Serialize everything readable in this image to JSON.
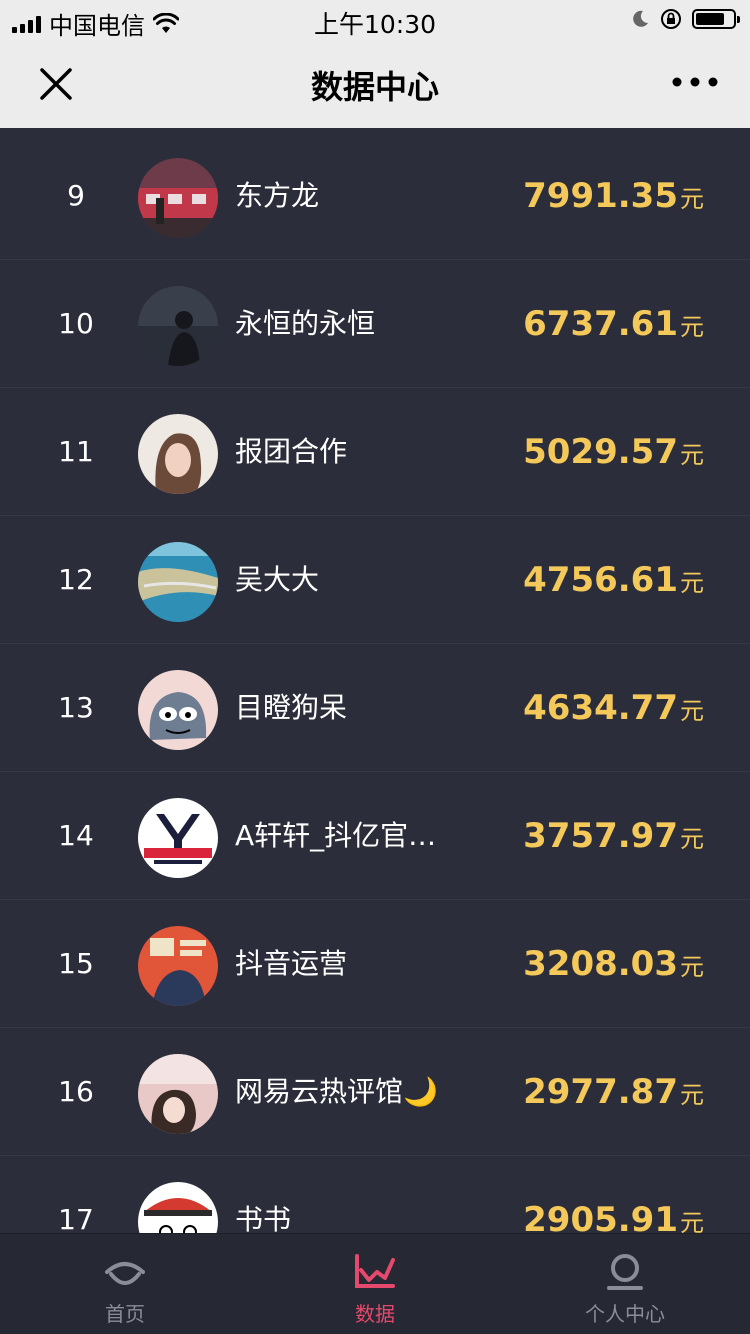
{
  "status_bar": {
    "carrier": "中国电信",
    "time": "上午10:30"
  },
  "nav": {
    "title": "数据中心"
  },
  "ranking": [
    {
      "rank": "9",
      "name": "东方龙",
      "amount": "7991.35",
      "unit": "元",
      "avatar": "red-train-photo"
    },
    {
      "rank": "10",
      "name": "永恒的永恒",
      "amount": "6737.61",
      "unit": "元",
      "avatar": "dark-silhouette-photo"
    },
    {
      "rank": "11",
      "name": "报团合作",
      "amount": "5029.57",
      "unit": "元",
      "avatar": "girl-portrait-photo"
    },
    {
      "rank": "12",
      "name": "吴大大",
      "amount": "4756.61",
      "unit": "元",
      "avatar": "coast-aerial-photo"
    },
    {
      "rank": "13",
      "name": "目瞪狗呆",
      "amount": "4634.77",
      "unit": "元",
      "avatar": "cartoon-cat-image"
    },
    {
      "rank": "14",
      "name": "A轩轩_抖亿官…",
      "amount": "3757.97",
      "unit": "元",
      "avatar": "y-logo-image"
    },
    {
      "rank": "15",
      "name": "抖音运营",
      "amount": "3208.03",
      "unit": "元",
      "avatar": "poster-image"
    },
    {
      "rank": "16",
      "name": "网易云热评馆🌙",
      "amount": "2977.87",
      "unit": "元",
      "avatar": "girl-pink-photo"
    },
    {
      "rank": "17",
      "name": "书书",
      "amount": "2905.91",
      "unit": "元",
      "avatar": "cartoon-hat-image"
    }
  ],
  "tabs": [
    {
      "label": "首页",
      "icon": "home-icon",
      "active": false
    },
    {
      "label": "数据",
      "icon": "chart-icon",
      "active": true
    },
    {
      "label": "个人中心",
      "icon": "profile-icon",
      "active": false
    }
  ],
  "colors": {
    "background": "#2b2d3a",
    "amount": "#f4c95a",
    "tab_active": "#e5496c",
    "tab_inactive": "#8a8c97"
  }
}
